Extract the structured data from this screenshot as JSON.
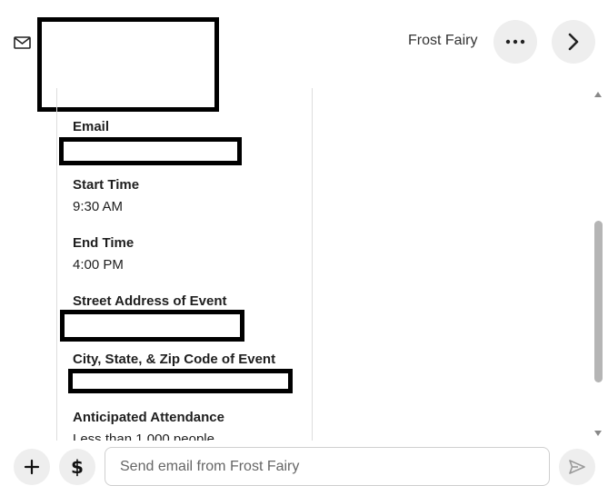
{
  "header": {
    "vendor_name": "Frost Fairy",
    "icons": {
      "mail": "envelope-icon",
      "more": "ellipsis-horizontal-icon",
      "next": "chevron-right-icon"
    }
  },
  "details": {
    "email": {
      "label": "Email",
      "value": ""
    },
    "start_time": {
      "label": "Start Time",
      "value": "9:30 AM"
    },
    "end_time": {
      "label": "End Time",
      "value": "4:00 PM"
    },
    "street_address": {
      "label": "Street Address of Event",
      "value": ""
    },
    "city_state_zip": {
      "label": "City, State, & Zip Code of Event",
      "value": ""
    },
    "attendance": {
      "label": "Anticipated Attendance",
      "value": "Less than 1,000 people"
    }
  },
  "composer": {
    "placeholder": "Send email from Frost Fairy",
    "dollar_symbol": "$",
    "icons": {
      "add": "plus-icon",
      "send": "send-icon"
    }
  }
}
